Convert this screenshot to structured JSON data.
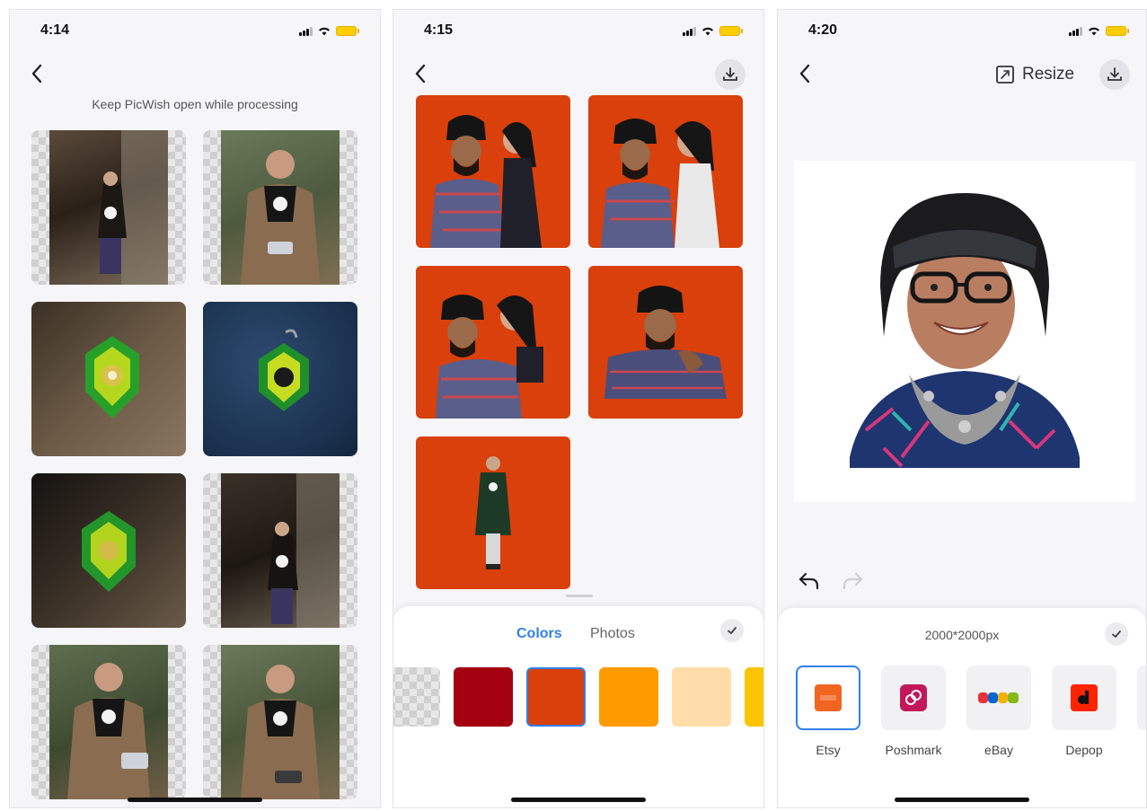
{
  "screen1": {
    "time": "4:14",
    "notice": "Keep PicWish open while processing"
  },
  "screen2": {
    "time": "4:15",
    "tabs": [
      {
        "label": "Colors",
        "active": true
      },
      {
        "label": "Photos",
        "active": false
      }
    ],
    "swatches": [
      "transparent",
      "#a30010",
      "#d9400b",
      "#ff9a00",
      "#ffdca8",
      "#ffc400"
    ],
    "selected_swatch": "#d9400b",
    "accent": "#2f80ed"
  },
  "screen3": {
    "time": "4:20",
    "resize_label": "Resize",
    "size_text": "2000*2000px",
    "marketplaces": [
      {
        "label": "Etsy",
        "icon": "etsy-icon",
        "selected": true
      },
      {
        "label": "Poshmark",
        "icon": "poshmark-icon",
        "selected": false
      },
      {
        "label": "eBay",
        "icon": "ebay-icon",
        "selected": false
      },
      {
        "label": "Depop",
        "icon": "depop-icon",
        "selected": false
      }
    ]
  }
}
